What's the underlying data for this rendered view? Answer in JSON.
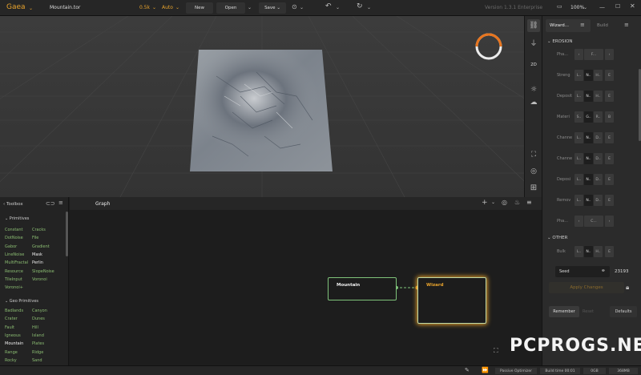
{
  "app": {
    "name": "Gaea",
    "file": "Mountain.tor",
    "resolution": "0.5k",
    "mode": "Auto",
    "version": "Version 1.3.1 Enterprise",
    "zoom": "100%"
  },
  "toolbar": {
    "new_label": "New",
    "open_label": "Open",
    "save_label": "Save"
  },
  "right_panel": {
    "tabs": [
      "Wizard...",
      "Build"
    ],
    "erosion_title": "EROSION",
    "rows": [
      {
        "label": "Pha...",
        "segs": [
          "F..."
        ]
      },
      {
        "label": "Streng",
        "segs": [
          "L..",
          "N..",
          "H..",
          "E"
        ]
      },
      {
        "label": "Deposit",
        "segs": [
          "L..",
          "N..",
          "H..",
          "E"
        ]
      },
      {
        "label": "Materi",
        "segs": [
          "S..",
          "G..",
          "R..",
          "B"
        ]
      },
      {
        "label": "Channe",
        "segs": [
          "L..",
          "N..",
          "D..",
          "E"
        ]
      },
      {
        "label": "Channe",
        "segs": [
          "L..",
          "N..",
          "D..",
          "E"
        ]
      },
      {
        "label": "Deposi",
        "segs": [
          "L..",
          "N..",
          "D..",
          "E"
        ]
      },
      {
        "label": "Remov",
        "segs": [
          "L..",
          "N..",
          "D..",
          "E"
        ]
      },
      {
        "label": "Pha...",
        "segs": [
          "C..."
        ]
      }
    ],
    "other_title": "OTHER",
    "bulk_label": "Bulk",
    "bulk_segs": [
      "L..",
      "N..",
      "H..",
      "E"
    ],
    "seed_label": "Seed",
    "seed_value": "23193",
    "apply_label": "Apply Changes",
    "remember_label": "Remember",
    "reset_label": "Reset",
    "defaults_label": "Defaults"
  },
  "toolbox": {
    "title": "Toolbox",
    "primitives_title": "Primitives",
    "primitives": [
      [
        "Constant",
        "Cracks"
      ],
      [
        "DotNoise",
        "File"
      ],
      [
        "Gabor",
        "Gradient"
      ],
      [
        "LineNoise",
        "Mask"
      ],
      [
        "MultiFractal",
        "Perlin"
      ],
      [
        "Resource",
        "SlopeNoise"
      ],
      [
        "TileInput",
        "Voronoi"
      ],
      [
        "Voronoi+",
        ""
      ]
    ],
    "geo_title": "Geo Primitives",
    "geo": [
      [
        "Badlands",
        "Canyon"
      ],
      [
        "Crater",
        "Dunes"
      ],
      [
        "Fault",
        "Hill"
      ],
      [
        "Igneous",
        "Island"
      ],
      [
        "Mountain",
        "Plates"
      ],
      [
        "Range",
        "Ridge"
      ],
      [
        "Rocky",
        "Sand"
      ]
    ],
    "highlighted": [
      "Mask",
      "Perlin",
      "Mountain"
    ]
  },
  "graph": {
    "title": "Graph",
    "node_mountain": "Mountain",
    "node_wizard": "Wizard"
  },
  "status": {
    "optimizer": "Passive Optimizer",
    "build_time": "Build time 00:01",
    "mem1": "0GB",
    "mem2": "368MB"
  },
  "watermark": "PCPROGS.NET",
  "colors": {
    "accent": "#e8a32c",
    "node_green": "#7fc27a",
    "item_green": "#8cbe73"
  }
}
